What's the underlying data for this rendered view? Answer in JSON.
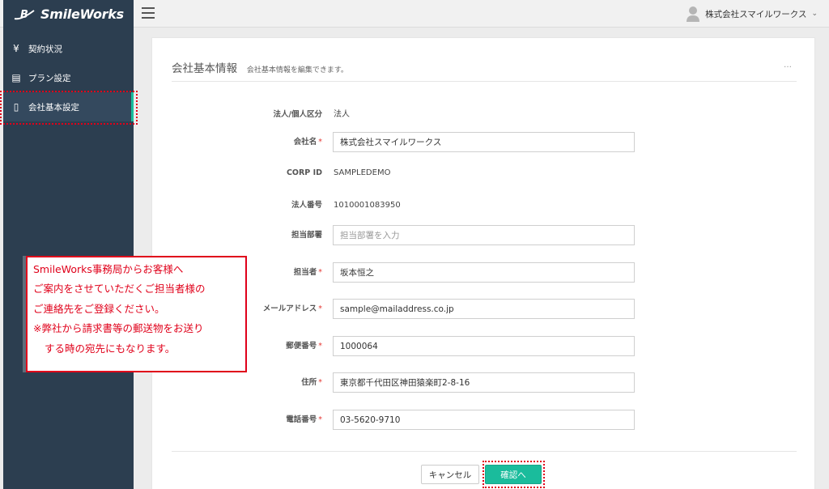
{
  "app": {
    "logo_text": "SmileWorks"
  },
  "header": {
    "user_name": "株式会社スマイルワークス",
    "chevron": "⌄"
  },
  "sidebar": {
    "items": [
      {
        "icon": "yen-icon",
        "glyph": "¥",
        "label": "契約状況"
      },
      {
        "icon": "list-icon",
        "glyph": "▤",
        "label": "プラン設定"
      },
      {
        "icon": "document-icon",
        "glyph": "▯",
        "label": "会社基本設定"
      }
    ],
    "active_index": 2
  },
  "panel": {
    "title": "会社基本情報",
    "subtitle": "会社基本情報を編集できます。",
    "dots": "…"
  },
  "form": {
    "corp_type": {
      "label": "法人/個人区分",
      "value": "法人"
    },
    "company_name": {
      "label": "会社名",
      "required_mark": "*",
      "value": "株式会社スマイルワークス"
    },
    "corp_id": {
      "label": "CORP ID",
      "value": "SAMPLEDEMO"
    },
    "corp_number": {
      "label": "法人番号",
      "value": "1010001083950"
    },
    "department": {
      "label": "担当部署",
      "value": "",
      "placeholder": "担当部署を入力"
    },
    "person": {
      "label": "担当者",
      "required_mark": "*",
      "value": "坂本恒之"
    },
    "email": {
      "label": "メールアドレス",
      "required_mark": "*",
      "value": "sample@mailaddress.co.jp"
    },
    "postal": {
      "label": "郵便番号",
      "required_mark": "*",
      "value": "1000064"
    },
    "address": {
      "label": "住所",
      "required_mark": "*",
      "value": "東京都千代田区神田猿楽町2-8-16"
    },
    "phone": {
      "label": "電話番号",
      "required_mark": "*",
      "value": "03-5620-9710"
    }
  },
  "buttons": {
    "cancel": "キャンセル",
    "confirm": "確認へ"
  },
  "callout": {
    "lines": [
      "SmileWorks事務局からお客様へ",
      "ご案内をさせていただくご担当者様の",
      "ご連絡先をご登録ください。",
      "※弊社から請求書等の郵送物をお送り",
      "する時の宛先にもなります。"
    ]
  },
  "colors": {
    "sidebar_bg": "#2c3e50",
    "accent": "#1abc9c",
    "highlight_red": "#e0001a"
  }
}
